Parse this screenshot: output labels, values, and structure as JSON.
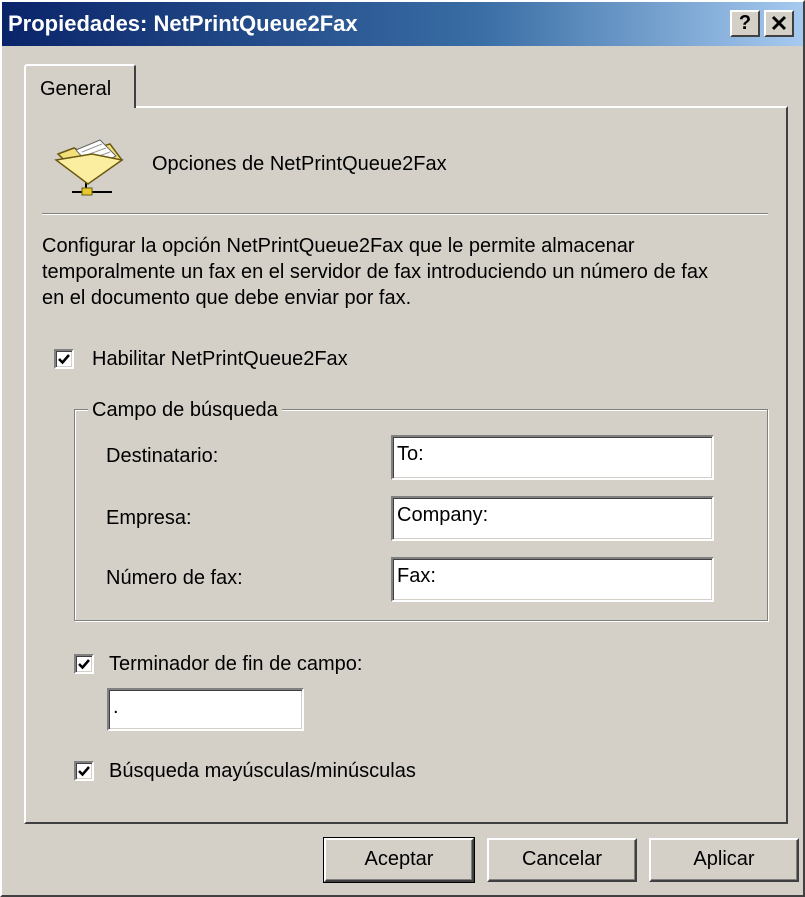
{
  "window": {
    "title": "Propiedades: NetPrintQueue2Fax",
    "help_label": "?",
    "close_label": "✕"
  },
  "tabs": [
    {
      "label": "General"
    }
  ],
  "header": {
    "icon": "folder-icon",
    "title": "Opciones de NetPrintQueue2Fax"
  },
  "description": [
    "Configurar la opción NetPrintQueue2Fax que le permite almacenar",
    "temporalmente un fax en el servidor de fax introduciendo un número de fax",
    "en el documento que debe enviar por fax."
  ],
  "enable_checkbox": {
    "label": "Habilitar NetPrintQueue2Fax",
    "checked": true
  },
  "search_group": {
    "legend": "Campo de búsqueda",
    "fields": [
      {
        "label": "Destinatario:",
        "value": "To:"
      },
      {
        "label": "Empresa:",
        "value": "Company:"
      },
      {
        "label": "Número de fax:",
        "value": "Fax:"
      }
    ]
  },
  "terminator": {
    "label": "Terminador de fin de campo:",
    "checked": true,
    "value": "."
  },
  "case_checkbox": {
    "label": "Búsqueda mayúsculas/minúsculas",
    "checked": true
  },
  "buttons": {
    "ok": "Aceptar",
    "cancel": "Cancelar",
    "apply": "Aplicar"
  }
}
